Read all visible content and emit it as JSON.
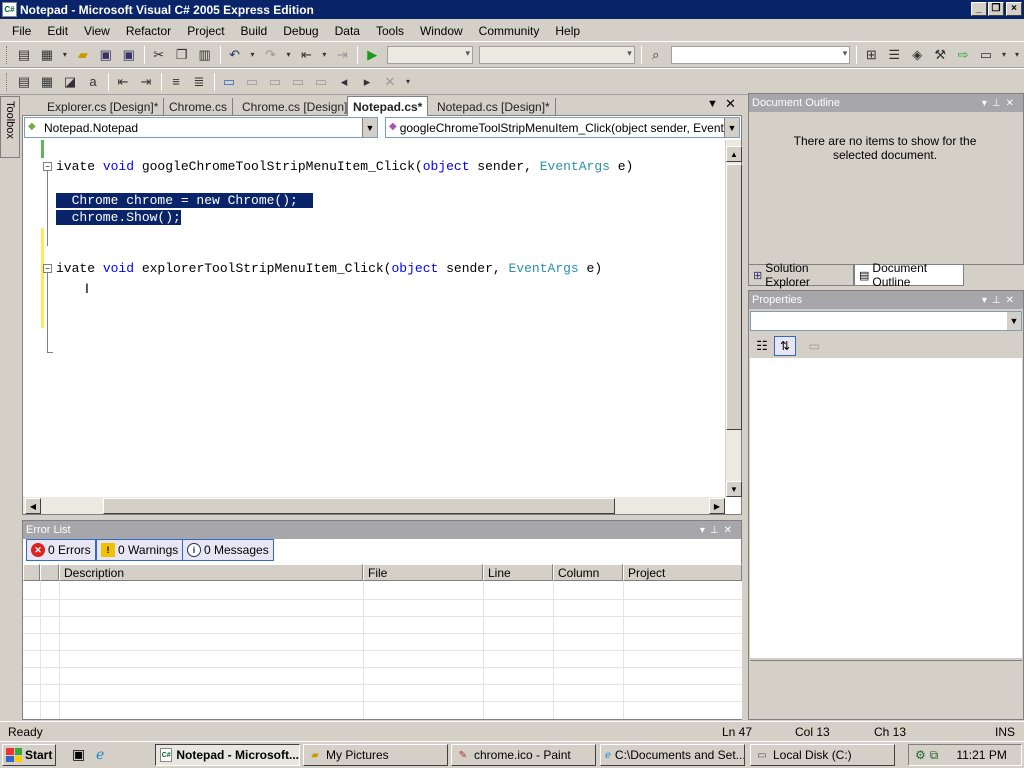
{
  "window": {
    "title": "Notepad - Microsoft Visual C# 2005 Express Edition",
    "app_icon": "C#"
  },
  "menu": [
    "File",
    "Edit",
    "View",
    "Refactor",
    "Project",
    "Build",
    "Debug",
    "Data",
    "Tools",
    "Window",
    "Community",
    "Help"
  ],
  "toolbox_label": "Toolbox",
  "doc_tabs": [
    {
      "label": "Explorer.cs [Design]*",
      "active": false
    },
    {
      "label": "Chrome.cs",
      "active": false
    },
    {
      "label": "Chrome.cs [Design]",
      "active": false
    },
    {
      "label": "Notepad.cs*",
      "active": true
    },
    {
      "label": "Notepad.cs [Design]*",
      "active": false
    }
  ],
  "nav": {
    "class_combo": "Notepad.Notepad",
    "member_combo": "googleChromeToolStripMenuItem_Click(object sender, EventArgs e)"
  },
  "code": {
    "line1": {
      "a": "ivate ",
      "kw1": "void",
      "b": " googleChromeToolStripMenuItem_Click(",
      "kw2": "object",
      "c": " sender, ",
      "ty": "EventArgs",
      "d": " e)"
    },
    "line2": "  Chrome chrome = new Chrome();",
    "line3": "  chrome.Show();",
    "line4": {
      "a": "ivate ",
      "kw1": "void",
      "b": " explorerToolStripMenuItem_Click(",
      "kw2": "object",
      "c": " sender, ",
      "ty": "EventArgs",
      "d": " e)"
    }
  },
  "error_list": {
    "title": "Error List",
    "errors": "0 Errors",
    "warnings": "0 Warnings",
    "messages": "0 Messages",
    "columns": [
      "Description",
      "File",
      "Line",
      "Column",
      "Project"
    ]
  },
  "document_outline": {
    "title": "Document Outline",
    "message": "There are no items to show for the selected document."
  },
  "right_tabs": {
    "solution": "Solution Explorer",
    "outline": "Document Outline"
  },
  "properties": {
    "title": "Properties"
  },
  "status": {
    "ready": "Ready",
    "ln": "Ln 47",
    "col": "Col 13",
    "ch": "Ch 13",
    "mode": "INS"
  },
  "taskbar": {
    "start": "Start",
    "tasks": [
      "Notepad - Microsoft...",
      "My Pictures",
      "chrome.ico - Paint",
      "C:\\Documents and Set...",
      "Local Disk (C:)"
    ],
    "clock": "11:21 PM"
  }
}
